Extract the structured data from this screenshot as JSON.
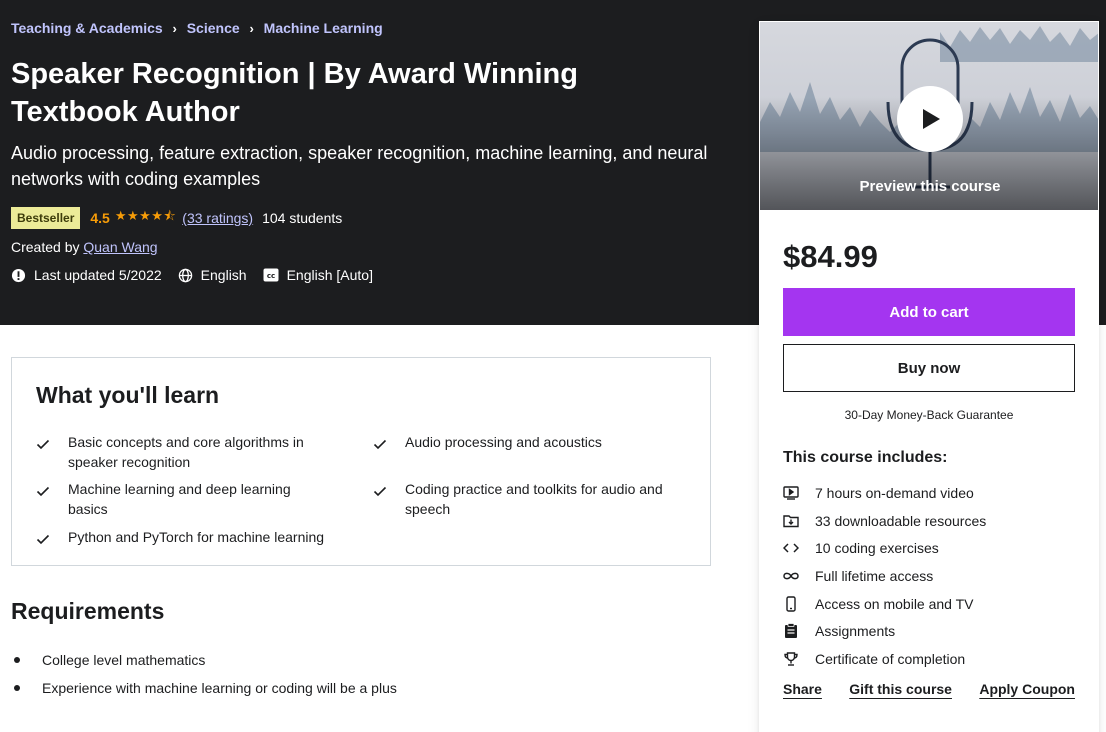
{
  "breadcrumb": [
    "Teaching & Academics",
    "Science",
    "Machine Learning"
  ],
  "course": {
    "title": "Speaker Recognition | By Award Winning Textbook Author",
    "subtitle": "Audio processing, feature extraction, speaker recognition, machine learning, and neural networks with coding examples",
    "badge": "Bestseller",
    "rating": "4.5",
    "stars": "★★★★⯪",
    "ratings_count": "(33 ratings)",
    "students": "104 students",
    "created_by_label": "Created by",
    "author": "Quan Wang",
    "last_updated": "Last updated 5/2022",
    "language": "English",
    "captions": "English [Auto]"
  },
  "sidebar": {
    "preview_label": "Preview this course",
    "price": "$84.99",
    "add_to_cart": "Add to cart",
    "buy_now": "Buy now",
    "guarantee": "30-Day Money-Back Guarantee",
    "includes_title": "This course includes:",
    "includes": [
      {
        "icon": "video-icon",
        "label": "7 hours on-demand video"
      },
      {
        "icon": "download-folder-icon",
        "label": "33 downloadable resources"
      },
      {
        "icon": "code-icon",
        "label": "10 coding exercises"
      },
      {
        "icon": "infinity-icon",
        "label": "Full lifetime access"
      },
      {
        "icon": "mobile-icon",
        "label": "Access on mobile and TV"
      },
      {
        "icon": "assignment-icon",
        "label": "Assignments"
      },
      {
        "icon": "trophy-icon",
        "label": "Certificate of completion"
      }
    ],
    "links": {
      "share": "Share",
      "gift": "Gift this course",
      "coupon": "Apply Coupon"
    }
  },
  "learn": {
    "title": "What you'll learn",
    "items": [
      "Basic concepts and core algorithms in speaker recognition",
      "Audio processing and acoustics",
      "Machine learning and deep learning basics",
      "Coding practice and toolkits for audio and speech",
      "Python and PyTorch for machine learning"
    ]
  },
  "requirements": {
    "title": "Requirements",
    "items": [
      "College level mathematics",
      "Experience with machine learning or coding will be a plus"
    ]
  },
  "colors": {
    "accent": "#a435f0",
    "dark_bg": "#1c1d1f",
    "star": "#f69c08",
    "link": "#c0c4fc",
    "badge": "#eceb98"
  }
}
